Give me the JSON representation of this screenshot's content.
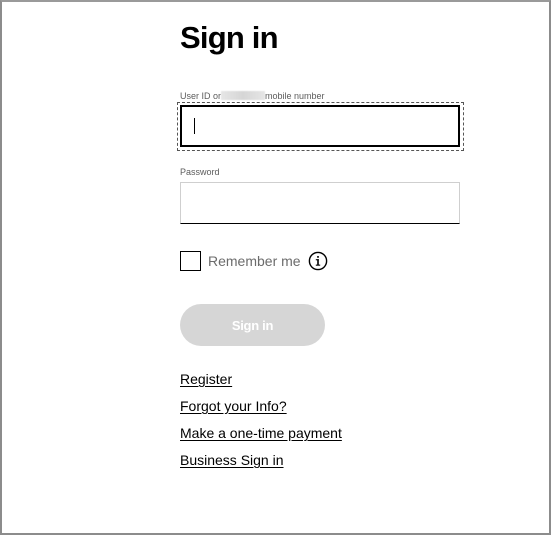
{
  "page": {
    "title": "Sign in"
  },
  "form": {
    "user_label_before": "User ID or",
    "user_label_after": "mobile number",
    "user_value": "",
    "password_label": "Password",
    "password_value": "",
    "remember_label": "Remember me",
    "remember_checked": false,
    "submit_label": "Sign in",
    "submit_enabled": false
  },
  "links": {
    "register": "Register",
    "forgot": "Forgot your Info?",
    "payment": "Make a one-time payment",
    "business": "Business Sign in"
  },
  "colors": {
    "button_disabled_bg": "#d6d6d6",
    "text": "#000000",
    "muted_text": "#6b6b6b"
  },
  "icons": {
    "info": "info-circle-icon",
    "caret": "text-caret"
  }
}
